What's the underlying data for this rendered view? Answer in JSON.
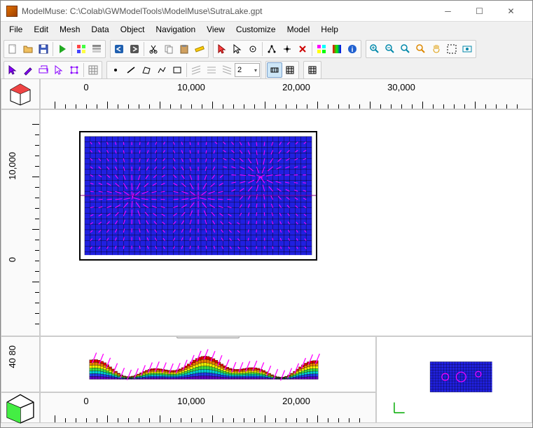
{
  "window": {
    "title": "ModelMuse: C:\\Colab\\GWModelTools\\ModelMuse\\SutraLake.gpt"
  },
  "menu": {
    "items": [
      "File",
      "Edit",
      "Mesh",
      "Data",
      "Object",
      "Navigation",
      "View",
      "Customize",
      "Model",
      "Help"
    ]
  },
  "toolbar": {
    "spin_value": "2"
  },
  "rulers": {
    "top": {
      "labels": [
        {
          "value": "0",
          "pos": 65
        },
        {
          "value": "10,000",
          "pos": 215
        },
        {
          "value": "20,000",
          "pos": 365
        },
        {
          "value": "30,000",
          "pos": 515
        }
      ]
    },
    "left": {
      "labels": [
        {
          "value": "10,000",
          "pos": 60
        },
        {
          "value": "0",
          "pos": 210
        }
      ]
    },
    "left2": {
      "labels": [
        {
          "value": "40 80",
          "pos": 12
        }
      ]
    },
    "bottom": {
      "labels": [
        {
          "value": "0",
          "pos": 65
        },
        {
          "value": "10,000",
          "pos": 215
        },
        {
          "value": "20,000",
          "pos": 365
        }
      ]
    }
  }
}
